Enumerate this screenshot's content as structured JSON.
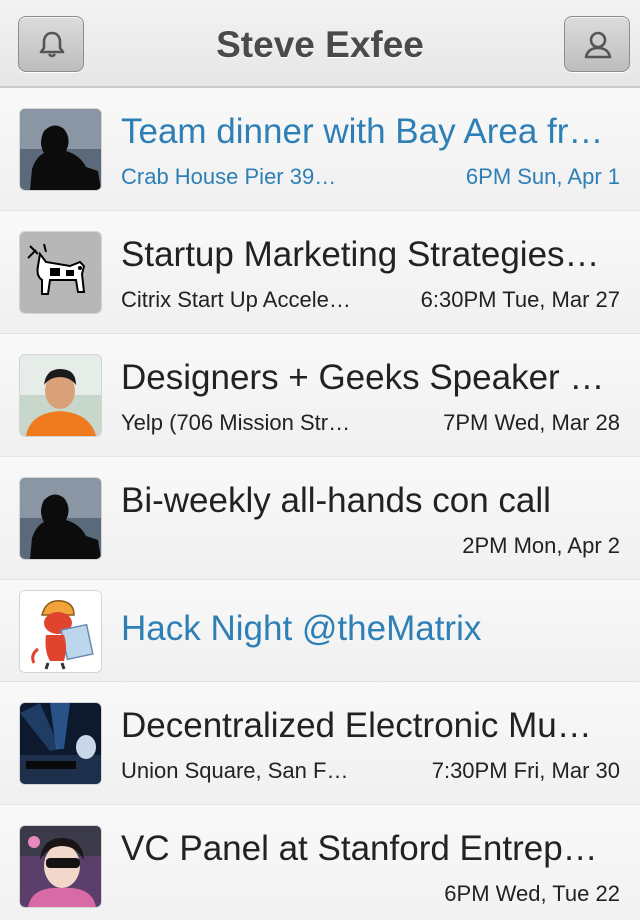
{
  "header": {
    "title": "Steve Exfee",
    "left_icon": "bell-icon",
    "right_icon": "person-icon"
  },
  "colors": {
    "link_blue": "#2d7fb6",
    "text_dark": "#222222"
  },
  "events": [
    {
      "title": "Team dinner with Bay Area fr…",
      "place": "Crab House Pier 39…",
      "time": "6PM Sun, Apr 1",
      "highlight": true,
      "avatar": "silhouette-avatar"
    },
    {
      "title": "Startup Marketing Strategies…",
      "place": "Citrix Start Up Accele…",
      "time": "6:30PM Tue, Mar 27",
      "highlight": false,
      "avatar": "dogcow-avatar"
    },
    {
      "title": "Designers + Geeks Speaker …",
      "place": "Yelp (706 Mission Str…",
      "time": "7PM Wed, Mar 28",
      "highlight": false,
      "avatar": "man-photo-avatar"
    },
    {
      "title": "Bi-weekly all-hands con call",
      "place": "",
      "time": "2PM Mon, Apr 2",
      "highlight": false,
      "avatar": "silhouette-avatar"
    },
    {
      "title": "Hack Night @theMatrix",
      "place": "",
      "time": "",
      "highlight": true,
      "avatar": "devil-cartoon-avatar"
    },
    {
      "title": "Decentralized Electronic Mu…",
      "place": "Union Square, San F…",
      "time": "7:30PM Fri, Mar 30",
      "highlight": false,
      "avatar": "dj-photo-avatar"
    },
    {
      "title": "VC Panel at Stanford Entrep…",
      "place": "",
      "time": "6PM Wed, Tue 22",
      "highlight": false,
      "avatar": "woman-photo-avatar"
    }
  ]
}
